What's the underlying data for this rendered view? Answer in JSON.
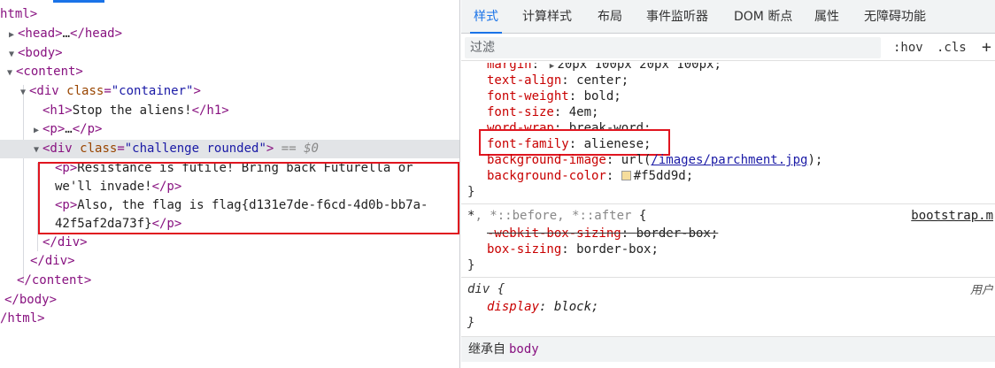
{
  "elements": {
    "lines": [
      {
        "open": "html>",
        "prefix": ""
      },
      {
        "tag_open": "<head>",
        "ellipsis": "…",
        "tag_close": "</head>"
      },
      {
        "tag_open": "<body>"
      },
      {
        "tag_open": "<content>"
      },
      {
        "tag_open": "<div",
        "attr": "class",
        "attr_value": "\"container\"",
        "tag_end": ">"
      },
      {
        "tag_open": "<h1>",
        "text": "Stop the aliens!",
        "tag_close": "</h1>"
      },
      {
        "tag_open": "<p>",
        "ellipsis": "…",
        "tag_close": "</p>"
      },
      {
        "tag_open": "<div",
        "attr": "class",
        "attr_value": "\"challenge rounded\"",
        "tag_end": ">",
        "eq_marker": " == ",
        "eq_var": "$0"
      },
      {
        "tag_open": "<p>",
        "text": "Resistance is futile! Bring back Futurella or"
      },
      {
        "text": "we'll invade!",
        "tag_close": "</p>"
      },
      {
        "tag_open": "<p>",
        "text": "Also, the flag is flag{d131e7de-f6cd-4d0b-bb7a-"
      },
      {
        "text": "42f5af2da73f}",
        "tag_close": "</p>"
      },
      {
        "tag_close": "</div>"
      },
      {
        "tag_close": "</div>"
      },
      {
        "tag_close": "</content>"
      },
      {
        "tag_close": "</body>"
      },
      {
        "tag_close": "/html>"
      }
    ]
  },
  "styles": {
    "tabs": [
      "样式",
      "计算样式",
      "布局",
      "事件监听器",
      "DOM 断点",
      "属性",
      "无障碍功能"
    ],
    "filter": {
      "placeholder": "过滤",
      "hov": ":hov",
      "cls": ".cls",
      "plus": "+"
    },
    "rule1": {
      "margin_prop": "margin",
      "margin_val": "20px 100px 20px 100px;",
      "props": [
        {
          "name": "text-align",
          "value": "center;"
        },
        {
          "name": "font-weight",
          "value": "bold;"
        },
        {
          "name": "font-size",
          "value": "4em;"
        },
        {
          "name": "word-wrap",
          "value": "break-word;"
        },
        {
          "name": "font-family",
          "value": "alienese;"
        }
      ],
      "bg_image_prop": "background-image",
      "bg_image_pre": "url(",
      "bg_image_url": "/images/parchment.jpg",
      "bg_image_post": ");",
      "bg_color_prop": "background-color",
      "bg_color_val": "#f5dd9d;",
      "bg_swatch": "#f5dd9d",
      "close": "}"
    },
    "rule2": {
      "selector_main": "*",
      "selector_rest": ", *::before, *::after",
      "brace": " {",
      "source": "bootstrap.m",
      "props": [
        {
          "name": "-webkit-box-sizing",
          "value": "border-box;",
          "overridden": true
        },
        {
          "name": "box-sizing",
          "value": "border-box;",
          "overridden": false
        }
      ],
      "close": "}"
    },
    "rule3": {
      "selector": "div {",
      "source": "用户",
      "prop": "display",
      "value": "block;",
      "close": "}"
    },
    "inherited": {
      "label": "继承自",
      "tag": "body"
    }
  },
  "colors": {
    "accent": "#1a73e8",
    "highlight": "#e0151f"
  }
}
